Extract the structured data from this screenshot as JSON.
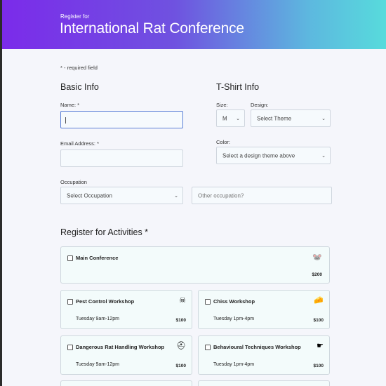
{
  "header": {
    "subtitle": "Register for",
    "title": "International Rat Conference"
  },
  "required_note": "* - required field",
  "basic_info": {
    "heading": "Basic Info",
    "name_label": "Name: *",
    "name_value": "",
    "email_label": "Email Address: *",
    "email_value": "",
    "occupation_label": "Occupation",
    "occupation_select": "Select Occupation",
    "other_occupation_placeholder": "Other occupation?"
  },
  "tshirt": {
    "heading": "T-Shirt Info",
    "size_label": "Size:",
    "size_value": "M",
    "design_label": "Design:",
    "design_value": "Select Theme",
    "color_label": "Color:",
    "color_value": "Select a design theme above"
  },
  "activities": {
    "heading": "Register for Activities *",
    "items": [
      {
        "name": "Main Conference",
        "time": "",
        "price": "$200",
        "icon": "mouse-icon"
      },
      {
        "name": "Pest Control Workshop",
        "time": "Tuesday 9am-12pm",
        "price": "$100",
        "icon": "skull-crossbones-icon"
      },
      {
        "name": "Chiss Workshop",
        "time": "Tuesday 1pm-4pm",
        "price": "$100",
        "icon": "cheese-icon"
      },
      {
        "name": "Dangerous Rat Handling Workshop",
        "time": "Tuesday 9am-12pm",
        "price": "$100",
        "icon": "helmet-icon"
      },
      {
        "name": "Behavioural Techniques Workshop",
        "time": "Tuesday 1pm-4pm",
        "price": "$100",
        "icon": "pointer-icon"
      }
    ]
  },
  "colors": {
    "header_gradient_start": "#7b2bea",
    "header_gradient_end": "#57dbdc",
    "page_background": "#f5f6fb",
    "card_background": "#f3fbfb",
    "focus_border": "#5b7fd6"
  }
}
